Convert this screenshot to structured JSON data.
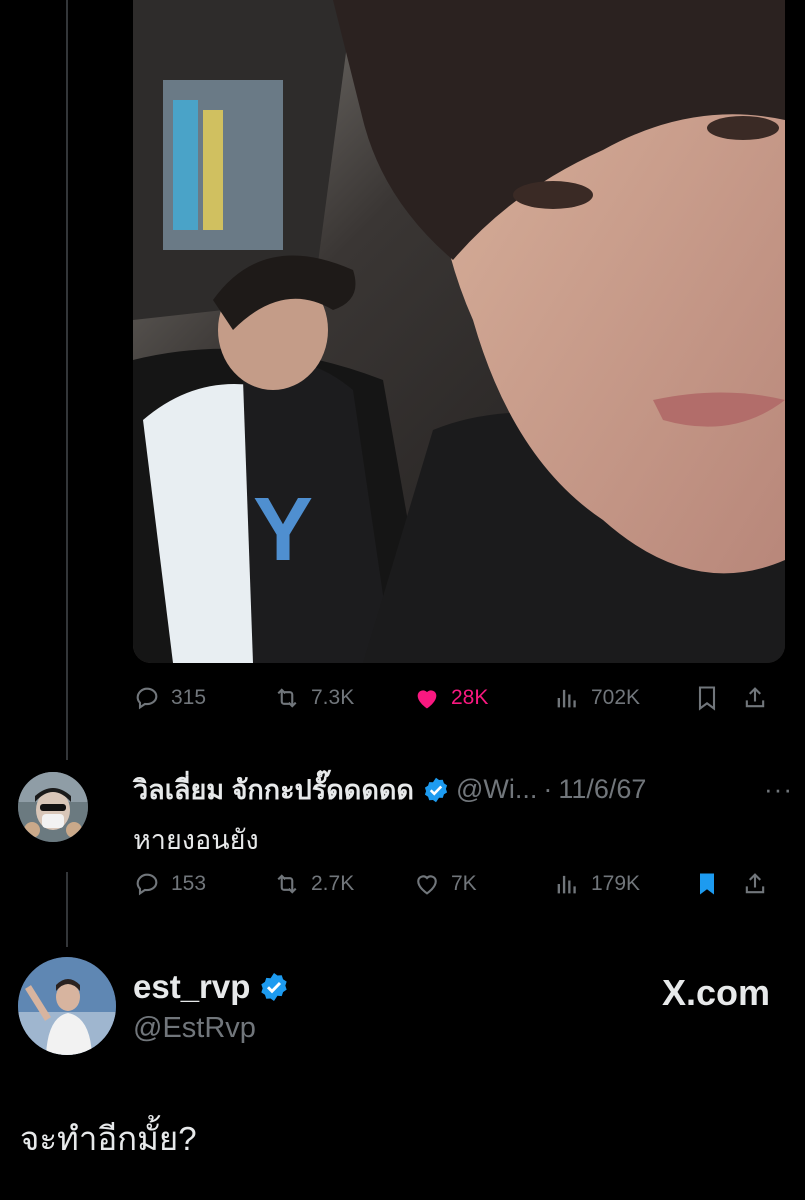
{
  "tweet": {
    "stats": {
      "replies": "315",
      "retweets": "7.3K",
      "likes": "28K",
      "views": "702K"
    },
    "icons": [
      "reply-icon",
      "retweet-icon",
      "like-icon-filled",
      "views-icon",
      "bookmark-icon",
      "share-icon"
    ],
    "accent_like": "#f91880"
  },
  "reply": {
    "name": "วิลเลี่ยม จักกะปรั๊ดดดดด",
    "handle": "@Wi...",
    "separator": "·",
    "date": "11/6/67",
    "more": "···",
    "text": "หายงอนยัง",
    "stats": {
      "replies": "153",
      "retweets": "2.7K",
      "likes": "7K",
      "views": "179K"
    },
    "accent_bookmark": "#1d9bf0"
  },
  "post": {
    "name": "est_rvp",
    "handle": "@EstRvp",
    "brand": "X.com",
    "text": "จะทำอีกมั้ย?"
  }
}
